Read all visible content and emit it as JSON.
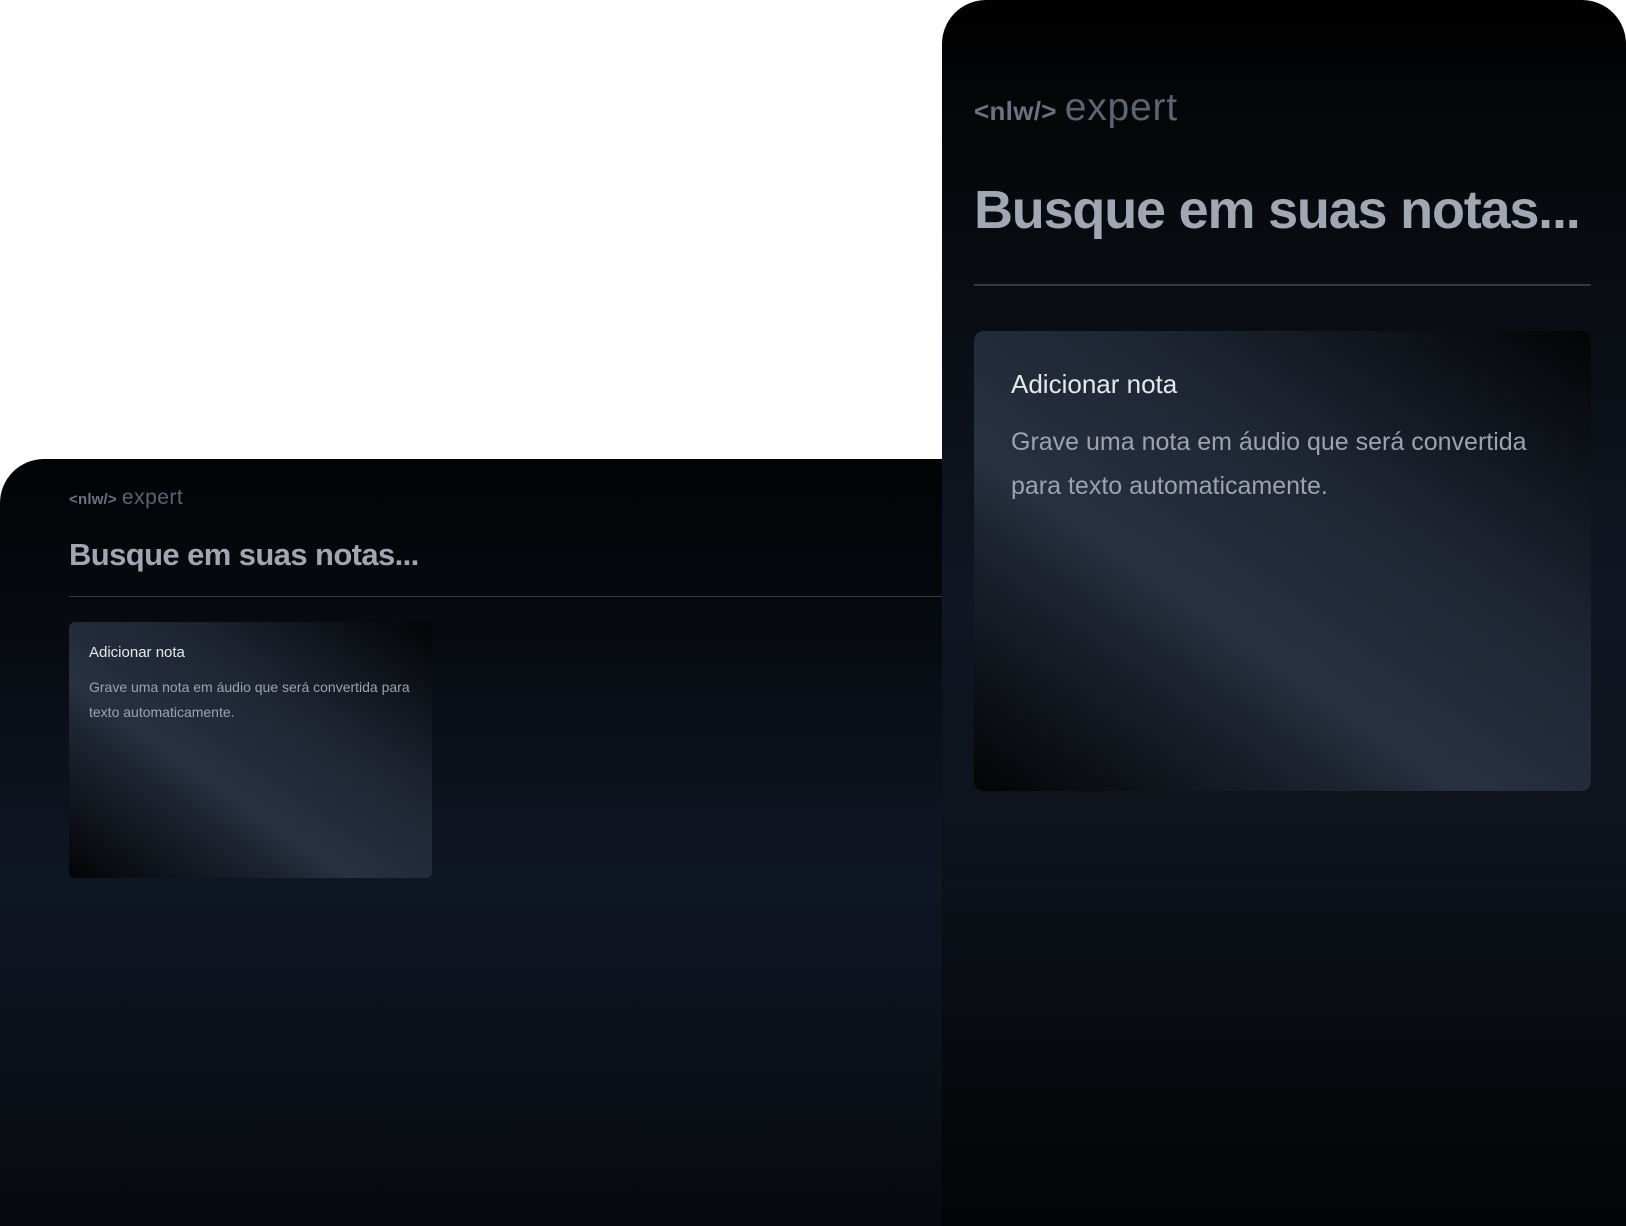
{
  "desktop": {
    "logo": {
      "nlw": "<nlw/>",
      "expert": "expert"
    },
    "search": {
      "placeholder": "Busque em suas notas..."
    },
    "add_note_card": {
      "title": "Adicionar nota",
      "description": "Grave uma nota em áudio que será convertida para texto automaticamente."
    }
  },
  "mobile": {
    "logo": {
      "nlw": "<nlw/>",
      "expert": "expert"
    },
    "search": {
      "placeholder": "Busque em suas notas..."
    },
    "add_note_card": {
      "title": "Adicionar nota",
      "description": "Grave uma nota em áudio que será convertida para texto automaticamente."
    }
  },
  "colors": {
    "background": "#0f1624",
    "card_highlight": "#283140",
    "title_text": "#e5e7eb",
    "muted_text": "#9ca3af",
    "divider": "#313a48"
  }
}
